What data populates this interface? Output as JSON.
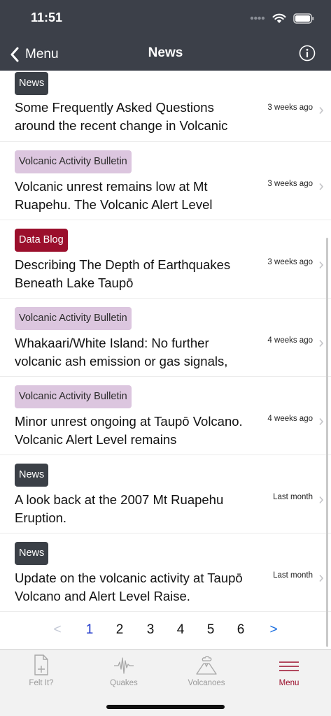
{
  "status": {
    "time": "11:51"
  },
  "navbar": {
    "back_label": "Menu",
    "title": "News"
  },
  "items": [
    {
      "badge": "News",
      "badge_type": "news",
      "title": "Some Frequently Asked Questions around the recent change in Volcanic",
      "time": "3 weeks ago"
    },
    {
      "badge": "Volcanic Activity Bulletin",
      "badge_type": "bulletin",
      "title": "Volcanic unrest remains low at Mt Ruapehu. The Volcanic Alert Level",
      "time": "3 weeks ago"
    },
    {
      "badge": "Data Blog",
      "badge_type": "blog",
      "title": "Describing The Depth of Earthquakes Beneath Lake Taupō",
      "time": "3 weeks ago"
    },
    {
      "badge": "Volcanic Activity Bulletin",
      "badge_type": "bulletin",
      "title": "Whakaari/White Island: No further volcanic ash emission or gas signals,",
      "time": "4 weeks ago"
    },
    {
      "badge": "Volcanic Activity Bulletin",
      "badge_type": "bulletin",
      "title": "Minor unrest ongoing at Taupō Volcano. Volcanic Alert Level remains",
      "time": "4 weeks ago"
    },
    {
      "badge": "News",
      "badge_type": "news",
      "title": "A look back at the 2007 Mt Ruapehu Eruption.",
      "time": "Last month"
    },
    {
      "badge": "News",
      "badge_type": "news",
      "title": "Update on the volcanic activity at Taupō Volcano and Alert Level Raise.",
      "time": "Last month"
    }
  ],
  "pagination": {
    "prev": "<",
    "pages": [
      "1",
      "2",
      "3",
      "4",
      "5",
      "6"
    ],
    "current": "1",
    "next": ">"
  },
  "tabs": [
    {
      "label": "Felt It?",
      "icon": "felt-it-icon"
    },
    {
      "label": "Quakes",
      "icon": "seismograph-icon"
    },
    {
      "label": "Volcanoes",
      "icon": "volcano-icon"
    },
    {
      "label": "Menu",
      "icon": "menu-icon",
      "active": true
    }
  ],
  "colors": {
    "header": "#3c4049",
    "accent": "#9b0f2c",
    "bulletin": "#dcc6df",
    "link": "#1a33c9"
  }
}
